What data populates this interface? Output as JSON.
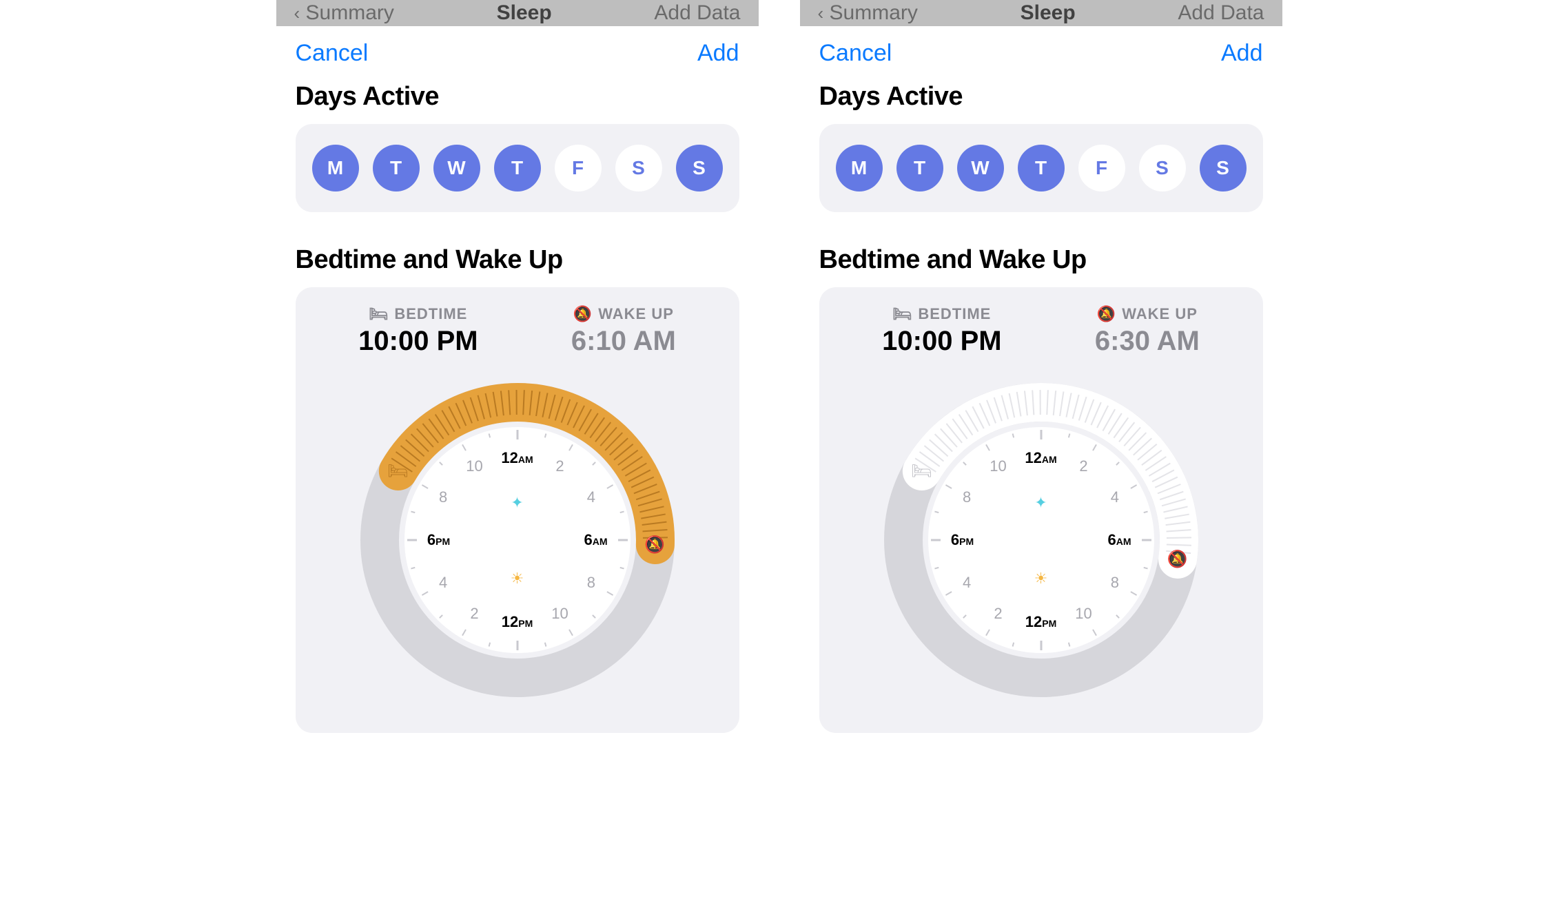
{
  "appBar": {
    "back": "Summary",
    "title": "Sleep",
    "action": "Add Data"
  },
  "sheetNav": {
    "cancel": "Cancel",
    "add": "Add"
  },
  "sections": {
    "days": "Days Active",
    "bedtime": "Bedtime and Wake Up"
  },
  "dayLetters": [
    "M",
    "T",
    "W",
    "T",
    "F",
    "S",
    "S"
  ],
  "labels": {
    "bedtime": "BEDTIME",
    "wakeup": "WAKE UP"
  },
  "clock": {
    "top": "12AM",
    "right": "6AM",
    "bottom": "12PM",
    "left": "6PM",
    "n2": "2",
    "n4": "4",
    "n8": "8",
    "n10": "10"
  },
  "screens": [
    {
      "daysActive": [
        true,
        true,
        true,
        true,
        false,
        false,
        true
      ],
      "bedtime": "10:00 PM",
      "wakeup": "6:10 AM",
      "arc": {
        "startDeg": 300,
        "endDeg": 92,
        "tint": "orange"
      }
    },
    {
      "daysActive": [
        true,
        true,
        true,
        true,
        false,
        false,
        true
      ],
      "bedtime": "10:00 PM",
      "wakeup": "6:30 AM",
      "arc": {
        "startDeg": 300,
        "endDeg": 98,
        "tint": "white"
      }
    }
  ],
  "colors": {
    "accent": "#0a7aff",
    "dayOn": "#6479e4",
    "arcOrange": "#e6a23c",
    "arcOrangeDark": "#b97a22",
    "ringGrey": "#d6d6db",
    "faceWhite": "#ffffff",
    "handleWhite": "#ffffff",
    "muted": "#8b8b92"
  }
}
